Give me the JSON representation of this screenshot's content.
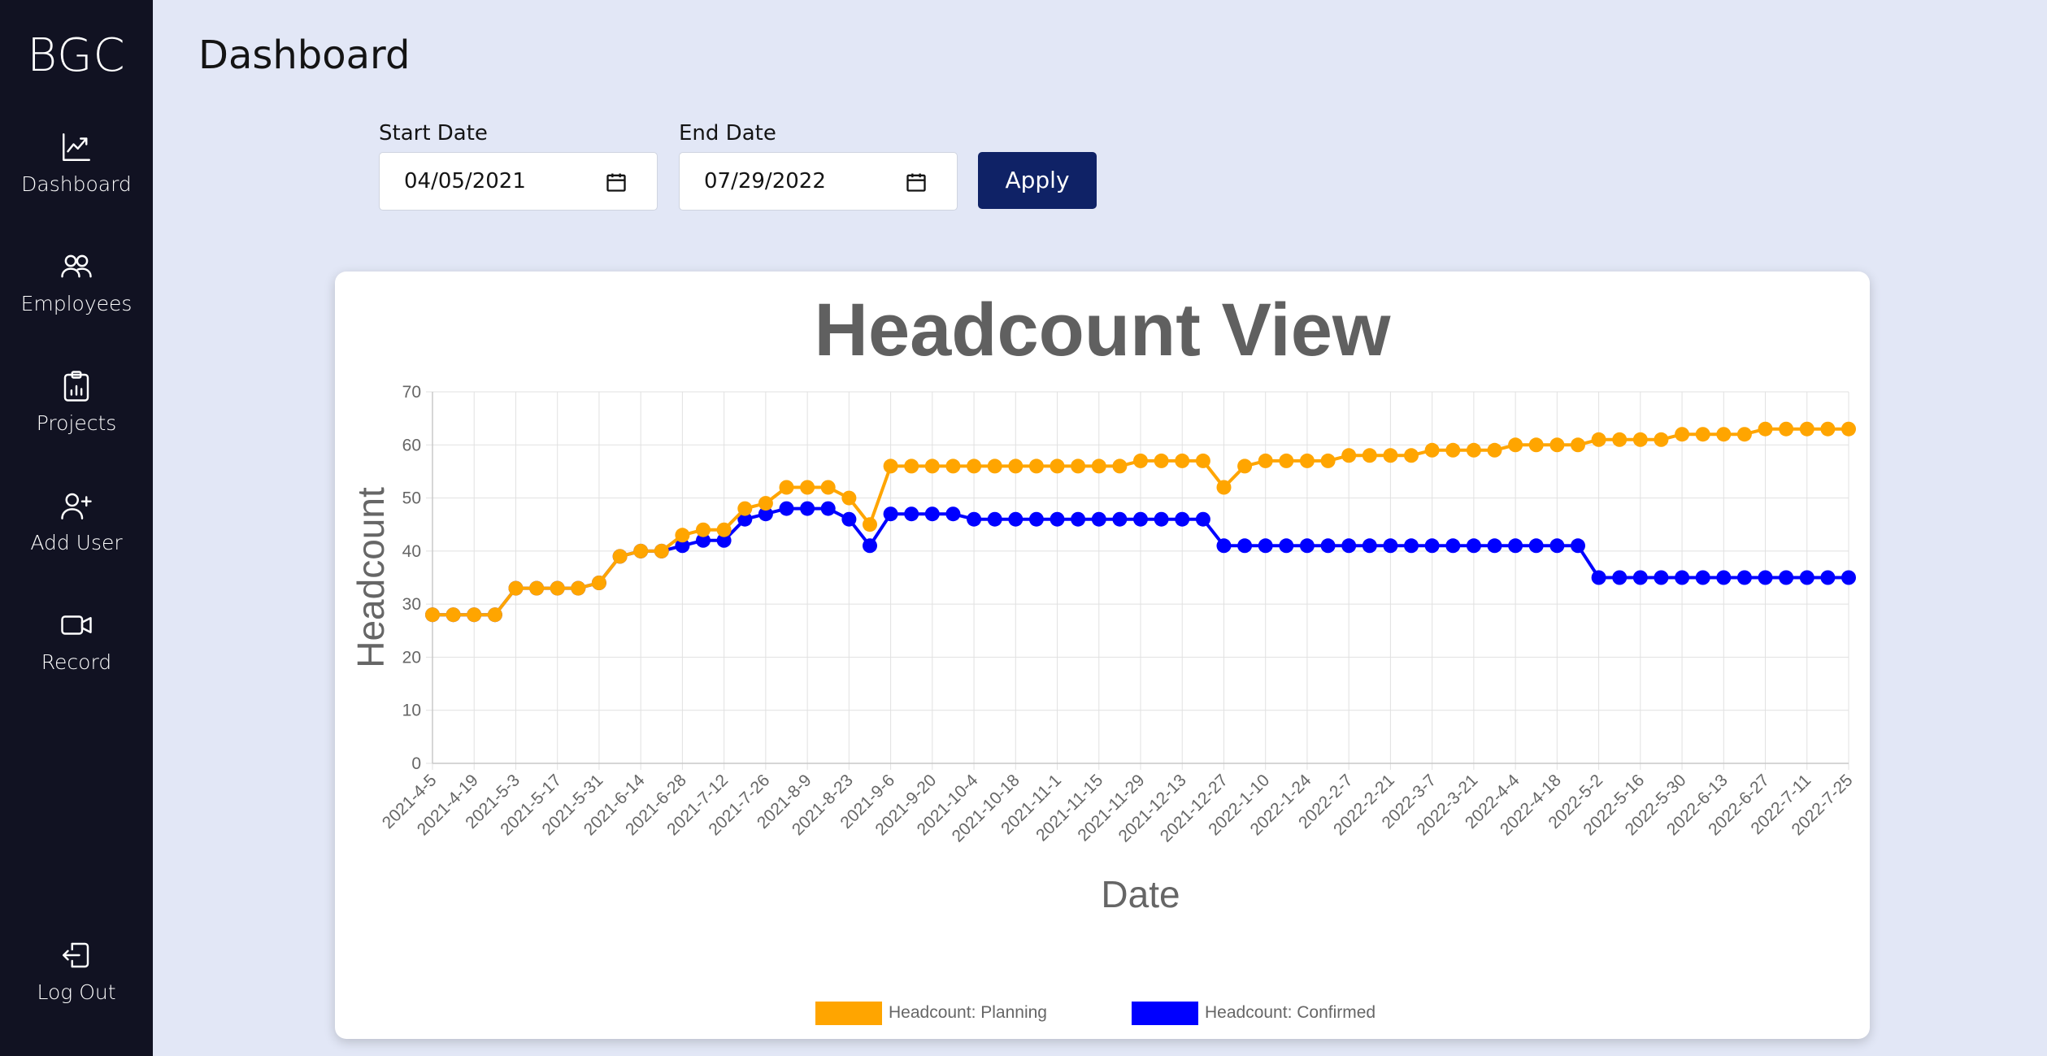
{
  "sidebar": {
    "brand": "BGC",
    "items": [
      {
        "label": "Dashboard",
        "icon": "chart-line-icon"
      },
      {
        "label": "Employees",
        "icon": "users-icon"
      },
      {
        "label": "Projects",
        "icon": "clipboard-chart-icon"
      },
      {
        "label": "Add User",
        "icon": "user-plus-icon"
      },
      {
        "label": "Record",
        "icon": "video-camera-icon"
      }
    ],
    "logout": {
      "label": "Log Out",
      "icon": "logout-icon"
    }
  },
  "header": {
    "title": "Dashboard"
  },
  "filters": {
    "start_label": "Start Date",
    "start_value": "04/05/2021",
    "end_label": "End Date",
    "end_value": "07/29/2022",
    "apply_label": "Apply"
  },
  "colors": {
    "planning": "#ffa500",
    "confirmed": "#0000ff",
    "sidebar": "#111222",
    "accent": "#0f2266"
  },
  "chart_data": {
    "type": "line",
    "title": "Headcount View",
    "xlabel": "Date",
    "ylabel": "Headcount",
    "ylim": [
      0,
      70
    ],
    "yticks": [
      0,
      10,
      20,
      30,
      40,
      50,
      60,
      70
    ],
    "grid": true,
    "legend_position": "bottom",
    "x": [
      "2021-4-5",
      "2021-4-12",
      "2021-4-19",
      "2021-4-26",
      "2021-5-3",
      "2021-5-10",
      "2021-5-17",
      "2021-5-24",
      "2021-5-31",
      "2021-6-7",
      "2021-6-14",
      "2021-6-21",
      "2021-6-28",
      "2021-7-5",
      "2021-7-12",
      "2021-7-19",
      "2021-7-26",
      "2021-8-2",
      "2021-8-9",
      "2021-8-16",
      "2021-8-23",
      "2021-8-30",
      "2021-9-6",
      "2021-9-13",
      "2021-9-20",
      "2021-9-27",
      "2021-10-4",
      "2021-10-11",
      "2021-10-18",
      "2021-10-25",
      "2021-11-1",
      "2021-11-8",
      "2021-11-15",
      "2021-11-22",
      "2021-11-29",
      "2021-12-6",
      "2021-12-13",
      "2021-12-20",
      "2021-12-27",
      "2022-1-3",
      "2022-1-10",
      "2022-1-17",
      "2022-1-24",
      "2022-1-31",
      "2022-2-7",
      "2022-2-14",
      "2022-2-21",
      "2022-2-28",
      "2022-3-7",
      "2022-3-14",
      "2022-3-21",
      "2022-3-28",
      "2022-4-4",
      "2022-4-11",
      "2022-4-18",
      "2022-4-25",
      "2022-5-2",
      "2022-5-9",
      "2022-5-16",
      "2022-5-23",
      "2022-5-30",
      "2022-6-6",
      "2022-6-13",
      "2022-6-20",
      "2022-6-27",
      "2022-7-4",
      "2022-7-11",
      "2022-7-18",
      "2022-7-25"
    ],
    "tick_labels": [
      "2021-4-5",
      "2021-4-19",
      "2021-5-3",
      "2021-5-17",
      "2021-5-31",
      "2021-6-14",
      "2021-6-28",
      "2021-7-12",
      "2021-7-26",
      "2021-8-9",
      "2021-8-23",
      "2021-9-6",
      "2021-9-20",
      "2021-10-4",
      "2021-10-18",
      "2021-11-1",
      "2021-11-15",
      "2021-11-29",
      "2021-12-13",
      "2021-12-27",
      "2022-1-10",
      "2022-1-24",
      "2022-2-7",
      "2022-2-21",
      "2022-3-7",
      "2022-3-21",
      "2022-4-4",
      "2022-4-18",
      "2022-5-2",
      "2022-5-16",
      "2022-5-30",
      "2022-6-13",
      "2022-6-27",
      "2022-7-11",
      "2022-7-25"
    ],
    "series": [
      {
        "name": "Headcount: Planning",
        "color": "#ffa500",
        "values": [
          28,
          28,
          28,
          28,
          33,
          33,
          33,
          33,
          34,
          39,
          40,
          40,
          43,
          44,
          44,
          48,
          49,
          52,
          52,
          52,
          50,
          45,
          56,
          56,
          56,
          56,
          56,
          56,
          56,
          56,
          56,
          56,
          56,
          56,
          57,
          57,
          57,
          57,
          52,
          56,
          57,
          57,
          57,
          57,
          58,
          58,
          58,
          58,
          59,
          59,
          59,
          59,
          60,
          60,
          60,
          60,
          61,
          61,
          61,
          61,
          62,
          62,
          62,
          62,
          63,
          63,
          63,
          63,
          63
        ]
      },
      {
        "name": "Headcount: Confirmed",
        "color": "#0000ff",
        "values": [
          28,
          28,
          28,
          28,
          33,
          33,
          33,
          33,
          34,
          39,
          40,
          40,
          41,
          42,
          42,
          46,
          47,
          48,
          48,
          48,
          46,
          41,
          47,
          47,
          47,
          47,
          46,
          46,
          46,
          46,
          46,
          46,
          46,
          46,
          46,
          46,
          46,
          46,
          41,
          41,
          41,
          41,
          41,
          41,
          41,
          41,
          41,
          41,
          41,
          41,
          41,
          41,
          41,
          41,
          41,
          41,
          35,
          35,
          35,
          35,
          35,
          35,
          35,
          35,
          35,
          35,
          35,
          35,
          35
        ]
      }
    ]
  }
}
